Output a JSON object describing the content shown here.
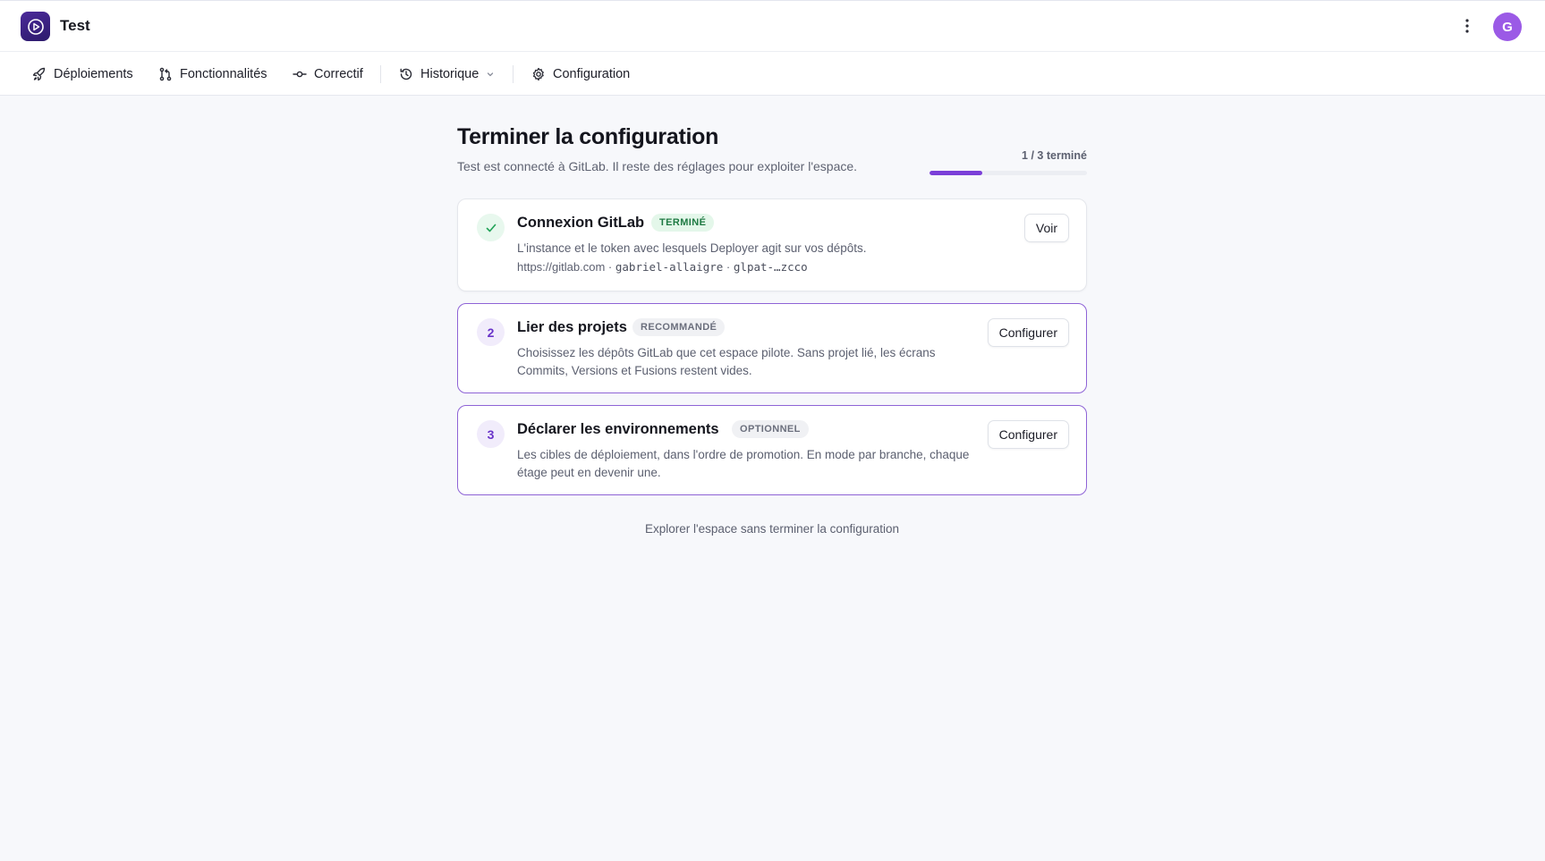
{
  "app": {
    "title": "Test",
    "avatar_initial": "G"
  },
  "nav": {
    "items": [
      {
        "label": "Déploiements",
        "icon": "rocket-icon"
      },
      {
        "label": "Fonctionnalités",
        "icon": "git-branch-icon"
      },
      {
        "label": "Correctif",
        "icon": "git-commit-icon"
      },
      {
        "label": "Historique",
        "icon": "history-icon"
      },
      {
        "label": "Configuration",
        "icon": "gear-icon"
      }
    ]
  },
  "setup": {
    "title": "Terminer la configuration",
    "subtitle": "Test est connecté à GitLab. Il reste des réglages pour exploiter l'espace.",
    "progress_label": "1 / 3 terminé",
    "progress_fraction": 0.333,
    "steps": [
      {
        "number": "",
        "status": "done",
        "title": "Connexion GitLab",
        "badge": "TERMINÉ",
        "description": "L'instance et le token avec lesquels Deployer agit sur vos dépôts.",
        "meta_url": "https://gitlab.com",
        "meta_user": "gabriel-allaigre",
        "meta_token": "glpat-…zcco",
        "meta_sep": "·",
        "action": "Voir"
      },
      {
        "number": "2",
        "status": "todo",
        "title": "Lier des projets",
        "badge": "RECOMMANDÉ",
        "description": "Choisissez les dépôts GitLab que cet espace pilote. Sans projet lié, les écrans Commits, Versions et Fusions restent vides.",
        "action": "Configurer"
      },
      {
        "number": "3",
        "status": "todo",
        "title": "Déclarer les environnements",
        "badge": "OPTIONNEL",
        "description": "Les cibles de déploiement, dans l'ordre de promotion. En mode par branche, chaque étage peut en devenir une.",
        "action": "Configurer"
      }
    ],
    "explore_link": "Explorer l'espace sans terminer la configuration"
  },
  "colors": {
    "accent": "#7b3fd8",
    "success": "#1f7a43",
    "avatar": "#9b5ae6"
  }
}
